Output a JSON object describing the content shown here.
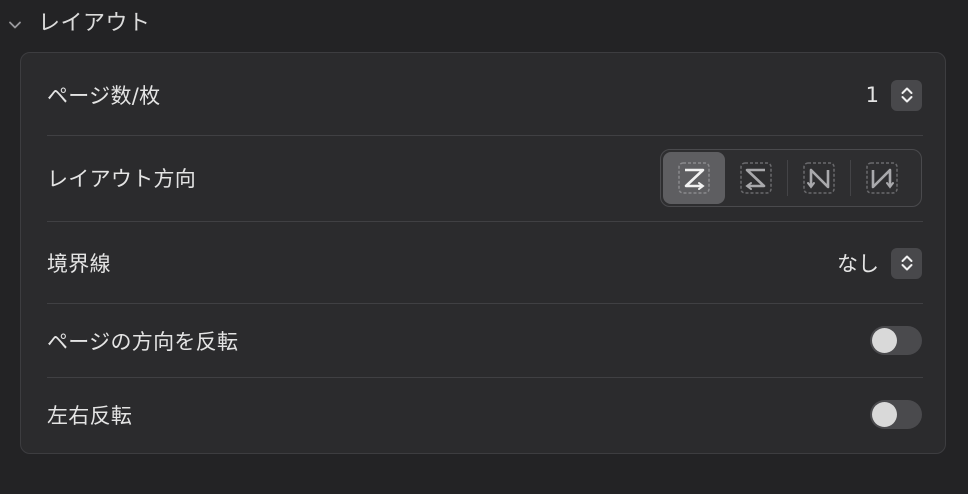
{
  "section": {
    "title": "レイアウト",
    "expanded": true
  },
  "rows": {
    "pages_per_sheet": {
      "label": "ページ数/枚",
      "value": "1"
    },
    "layout_direction": {
      "label": "レイアウト方向",
      "options": [
        {
          "icon": "z-layout-icon",
          "selected": true
        },
        {
          "icon": "reverse-z-layout-icon",
          "selected": false
        },
        {
          "icon": "reverse-n-layout-icon",
          "selected": false
        },
        {
          "icon": "n-layout-icon",
          "selected": false
        }
      ]
    },
    "border": {
      "label": "境界線",
      "value": "なし"
    },
    "reverse_orientation": {
      "label": "ページの方向を反転",
      "on": false
    },
    "flip_horizontal": {
      "label": "左右反転",
      "on": false
    }
  },
  "colors": {
    "background": "#232325",
    "panel": "#2b2b2d",
    "control": "#48484b",
    "selected_segment": "#5e5e61"
  }
}
